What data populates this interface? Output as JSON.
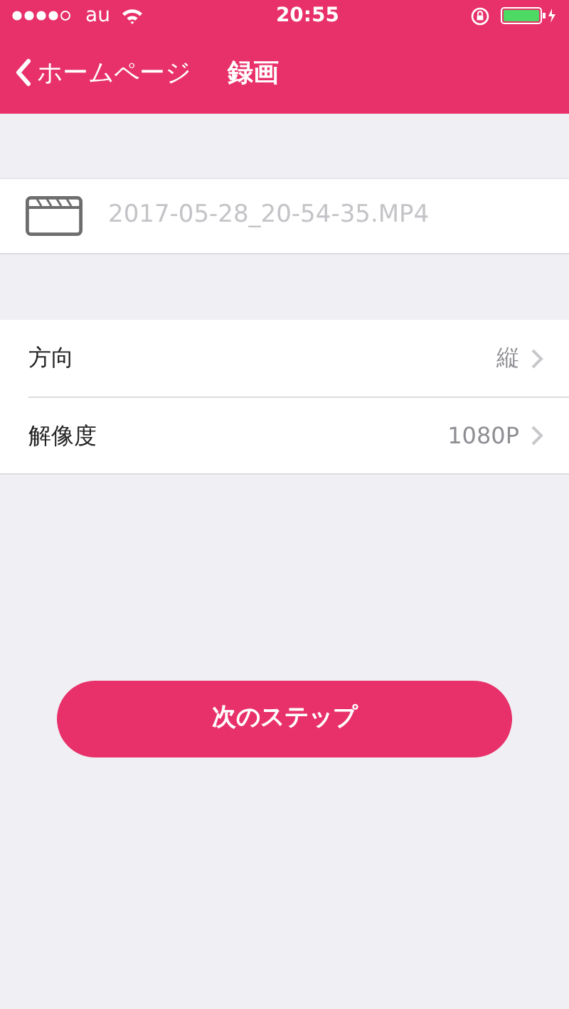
{
  "status_bar": {
    "carrier": "au",
    "time": "20:55"
  },
  "nav_bar": {
    "back_label": "ホームページ",
    "title": "録画"
  },
  "file_name": {
    "placeholder": "2017-05-28_20-54-35.MP4"
  },
  "settings": [
    {
      "label": "方向",
      "value": "縦"
    },
    {
      "label": "解像度",
      "value": "1080P"
    }
  ],
  "next_button": "次のステップ"
}
